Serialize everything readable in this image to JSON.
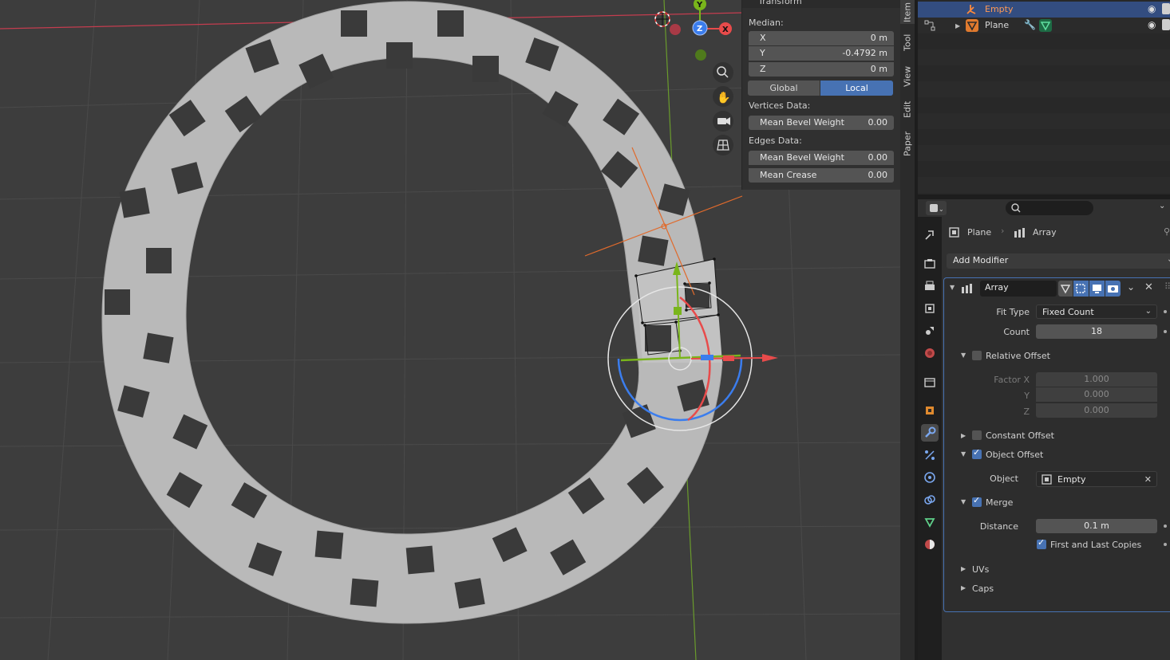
{
  "npanel": {
    "header": "Transform",
    "median_label": "Median:",
    "x_label": "X",
    "x_value": "0 m",
    "y_label": "Y",
    "y_value": "-0.4792 m",
    "z_label": "Z",
    "z_value": "0 m",
    "global_label": "Global",
    "local_label": "Local",
    "vertices_label": "Vertices Data:",
    "vert_bevel_label": "Mean Bevel Weight",
    "vert_bevel_value": "0.00",
    "edges_label": "Edges Data:",
    "edge_bevel_label": "Mean Bevel Weight",
    "edge_bevel_value": "0.00",
    "crease_label": "Mean Crease",
    "crease_value": "0.00"
  },
  "vtabs": [
    "Item",
    "Tool",
    "View",
    "Edit",
    "Paper"
  ],
  "gizmo": {
    "y": "Y",
    "z": "Z",
    "x": "X"
  },
  "outliner": {
    "items": [
      {
        "label": "Empty"
      },
      {
        "label": "Plane"
      }
    ]
  },
  "properties": {
    "breadcrumb_object": "Plane",
    "breadcrumb_modifier": "Array",
    "add_modifier": "Add Modifier",
    "modifier_name": "Array",
    "fit_type_label": "Fit Type",
    "fit_type_value": "Fixed Count",
    "count_label": "Count",
    "count_value": "18",
    "relative_offset": "Relative Offset",
    "factor_x_label": "Factor X",
    "factor_x_value": "1.000",
    "factor_y_label": "Y",
    "factor_y_value": "0.000",
    "factor_z_label": "Z",
    "factor_z_value": "0.000",
    "constant_offset": "Constant Offset",
    "object_offset": "Object Offset",
    "object_label": "Object",
    "object_value": "Empty",
    "merge": "Merge",
    "distance_label": "Distance",
    "distance_value": "0.1 m",
    "first_last": "First and Last Copies",
    "uvs": "UVs",
    "caps": "Caps"
  },
  "colors": {
    "accent": "#4772b3",
    "x_axis": "#e84b4b",
    "y_axis": "#79b51b",
    "z_axis": "#3b7ded",
    "selected_object": "#ff8a3c"
  }
}
